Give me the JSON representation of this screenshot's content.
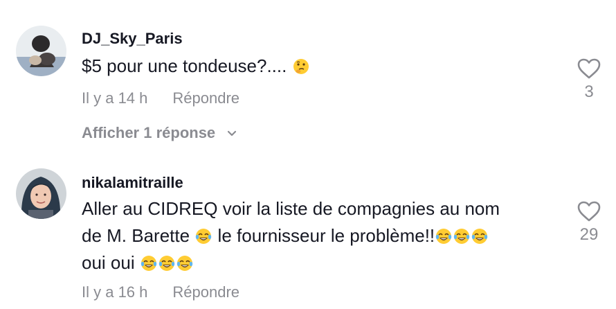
{
  "comments": [
    {
      "username": "DJ_Sky_Paris",
      "text": "$5 pour une tondeuse?....",
      "emojis": [
        "thinking-face"
      ],
      "time": "Il y a 14 h",
      "reply_label": "Répondre",
      "likes": "3",
      "view_replies": "Afficher 1 réponse"
    },
    {
      "username": "nikalamitraille",
      "text_line1": "Aller au CIDREQ voir la liste de compagnies au nom",
      "text_line2a": "de M. Barette",
      "text_line2b": "le fournisseur le problème!!",
      "text_line3": "oui oui",
      "emojis": [
        "tears-of-joy"
      ],
      "time": "Il y a 16 h",
      "reply_label": "Répondre",
      "likes": "29"
    }
  ],
  "colors": {
    "text": "#161823",
    "secondary": "#8a8b91",
    "emoji_yellow": "#ffcc33"
  }
}
